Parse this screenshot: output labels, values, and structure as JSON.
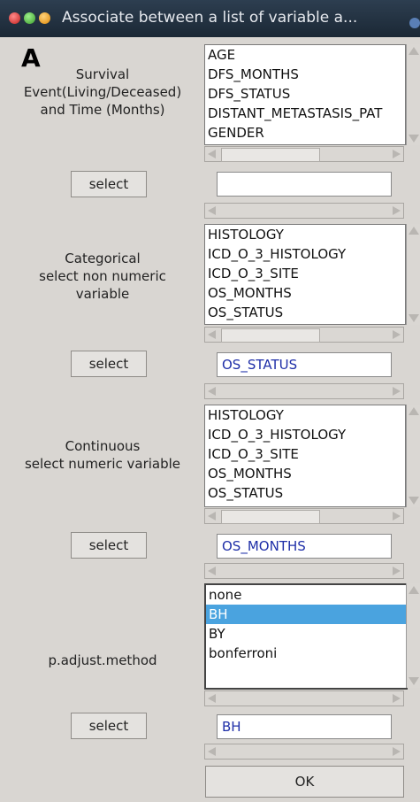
{
  "window": {
    "title": "Associate between a list of variable a..."
  },
  "panel_letter": "A",
  "survival": {
    "label_lines": [
      "Survival",
      "Event(Living/Deceased)",
      "and Time (Months)"
    ],
    "items": [
      "AGE",
      "DFS_MONTHS",
      "DFS_STATUS",
      "DISTANT_METASTASIS_PAT",
      "GENDER"
    ],
    "select_label": "select",
    "field_value": ""
  },
  "categorical": {
    "label_lines": [
      "Categorical",
      "select non numeric",
      "variable"
    ],
    "items": [
      "HISTOLOGY",
      "ICD_O_3_HISTOLOGY",
      "ICD_O_3_SITE",
      "OS_MONTHS",
      "OS_STATUS"
    ],
    "select_label": "select",
    "field_value": "OS_STATUS"
  },
  "continuous": {
    "label_lines": [
      "Continuous",
      "select numeric variable"
    ],
    "items": [
      "HISTOLOGY",
      "ICD_O_3_HISTOLOGY",
      "ICD_O_3_SITE",
      "OS_MONTHS",
      "OS_STATUS"
    ],
    "select_label": "select",
    "field_value": "OS_MONTHS"
  },
  "padjust": {
    "label": "p.adjust.method",
    "items": [
      "none",
      "BH",
      "BY",
      "bonferroni"
    ],
    "selected": "BH",
    "select_label": "select",
    "field_value": "BH"
  },
  "ok_label": "OK",
  "colors": {
    "selection": "#4aa3df",
    "field_text": "#1f2fa8",
    "titlebar": "#2d3e50"
  }
}
